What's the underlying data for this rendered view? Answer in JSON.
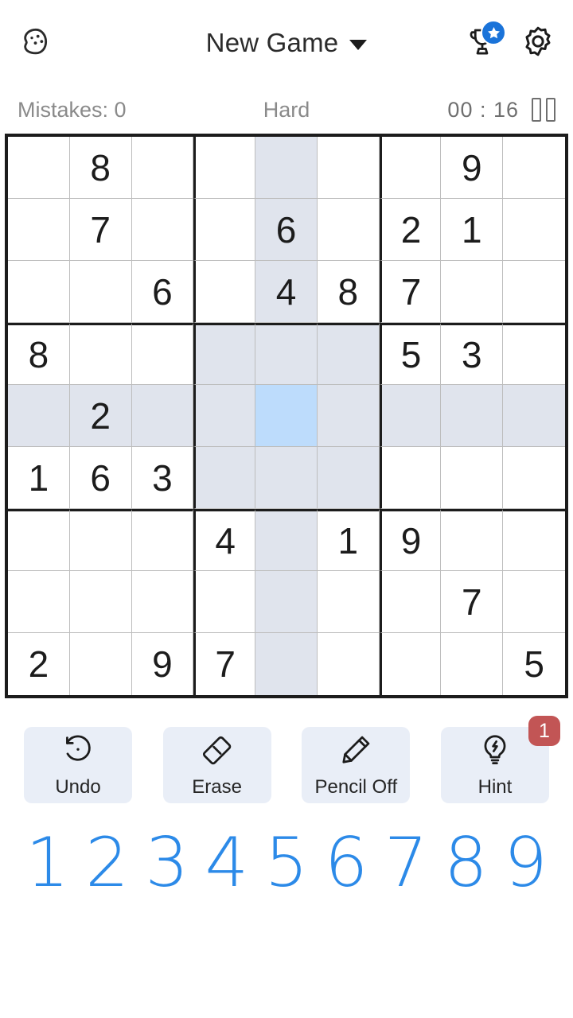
{
  "header": {
    "palette_icon": "palette-icon",
    "title": "New Game",
    "caret_icon": "chevron-down-icon",
    "trophy_icon": "trophy-icon",
    "star_badge_icon": "star-icon",
    "settings_icon": "gear-icon"
  },
  "status": {
    "mistakes_label": "Mistakes: 0",
    "difficulty": "Hard",
    "timer": "00 : 16",
    "pause_icon": "pause-icon"
  },
  "board": {
    "selected_cell": {
      "row": 4,
      "col": 4
    },
    "rows": [
      [
        "",
        "8",
        "",
        "",
        "",
        "",
        "",
        "9",
        ""
      ],
      [
        "",
        "7",
        "",
        "",
        "6",
        "",
        "2",
        "1",
        ""
      ],
      [
        "",
        "",
        "6",
        "",
        "4",
        "8",
        "7",
        "",
        ""
      ],
      [
        "8",
        "",
        "",
        "",
        "",
        "",
        "5",
        "3",
        ""
      ],
      [
        "",
        "2",
        "",
        "",
        "",
        "",
        "",
        "",
        ""
      ],
      [
        "1",
        "6",
        "3",
        "",
        "",
        "",
        "",
        "",
        ""
      ],
      [
        "",
        "",
        "",
        "4",
        "",
        "1",
        "9",
        "",
        ""
      ],
      [
        "",
        "",
        "",
        "",
        "",
        "",
        "",
        "7",
        ""
      ],
      [
        "2",
        "",
        "9",
        "7",
        "",
        "",
        "",
        "",
        "5"
      ]
    ]
  },
  "actions": [
    {
      "label": "Undo",
      "icon": "undo-icon"
    },
    {
      "label": "Erase",
      "icon": "eraser-icon"
    },
    {
      "label": "Pencil Off",
      "icon": "pencil-icon"
    },
    {
      "label": "Hint",
      "icon": "lightbulb-icon",
      "badge": "1"
    }
  ],
  "numpad": [
    "1",
    "2",
    "3",
    "4",
    "5",
    "6",
    "7",
    "8",
    "9"
  ],
  "colors": {
    "selected_cell": "#bddcfc",
    "highlight_cell": "#e0e4ed",
    "numpad_blue": "#2c8ae8",
    "badge_red": "#c25555",
    "accent_blue": "#1a73d9",
    "grid_line": "#1c1c1c",
    "button_bg": "#e9eef7"
  }
}
